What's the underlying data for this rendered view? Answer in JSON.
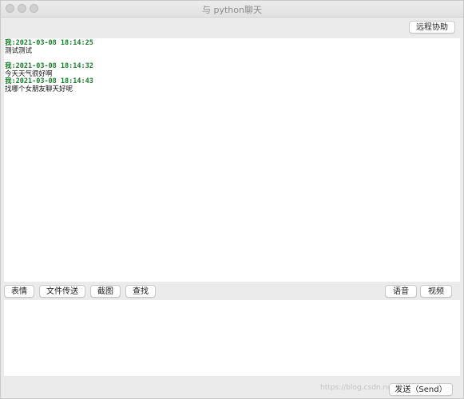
{
  "window": {
    "title": "与 python聊天"
  },
  "header": {
    "remote_assist_label": "远程协助"
  },
  "chat": {
    "messages": [
      {
        "header": "我:2021-03-08 18:14:25",
        "body": "测试测试"
      },
      {
        "header": "我:2021-03-08 18:14:32",
        "body": "今天天气很好啊"
      },
      {
        "header": "我:2021-03-08 18:14:43",
        "body": "找哪个女朋友聊天好呢"
      }
    ]
  },
  "toolbar": {
    "emoji_label": "表情",
    "file_transfer_label": "文件传送",
    "screenshot_label": "截图",
    "find_label": "查找",
    "voice_label": "语音",
    "video_label": "视频"
  },
  "composer": {
    "value": "",
    "send_label": "发送（Send）"
  },
  "watermark": {
    "text": "https://blog.csdn.net/..."
  },
  "colors": {
    "message_header": "#1a7f2a",
    "window_bg": "#ebebeb"
  }
}
